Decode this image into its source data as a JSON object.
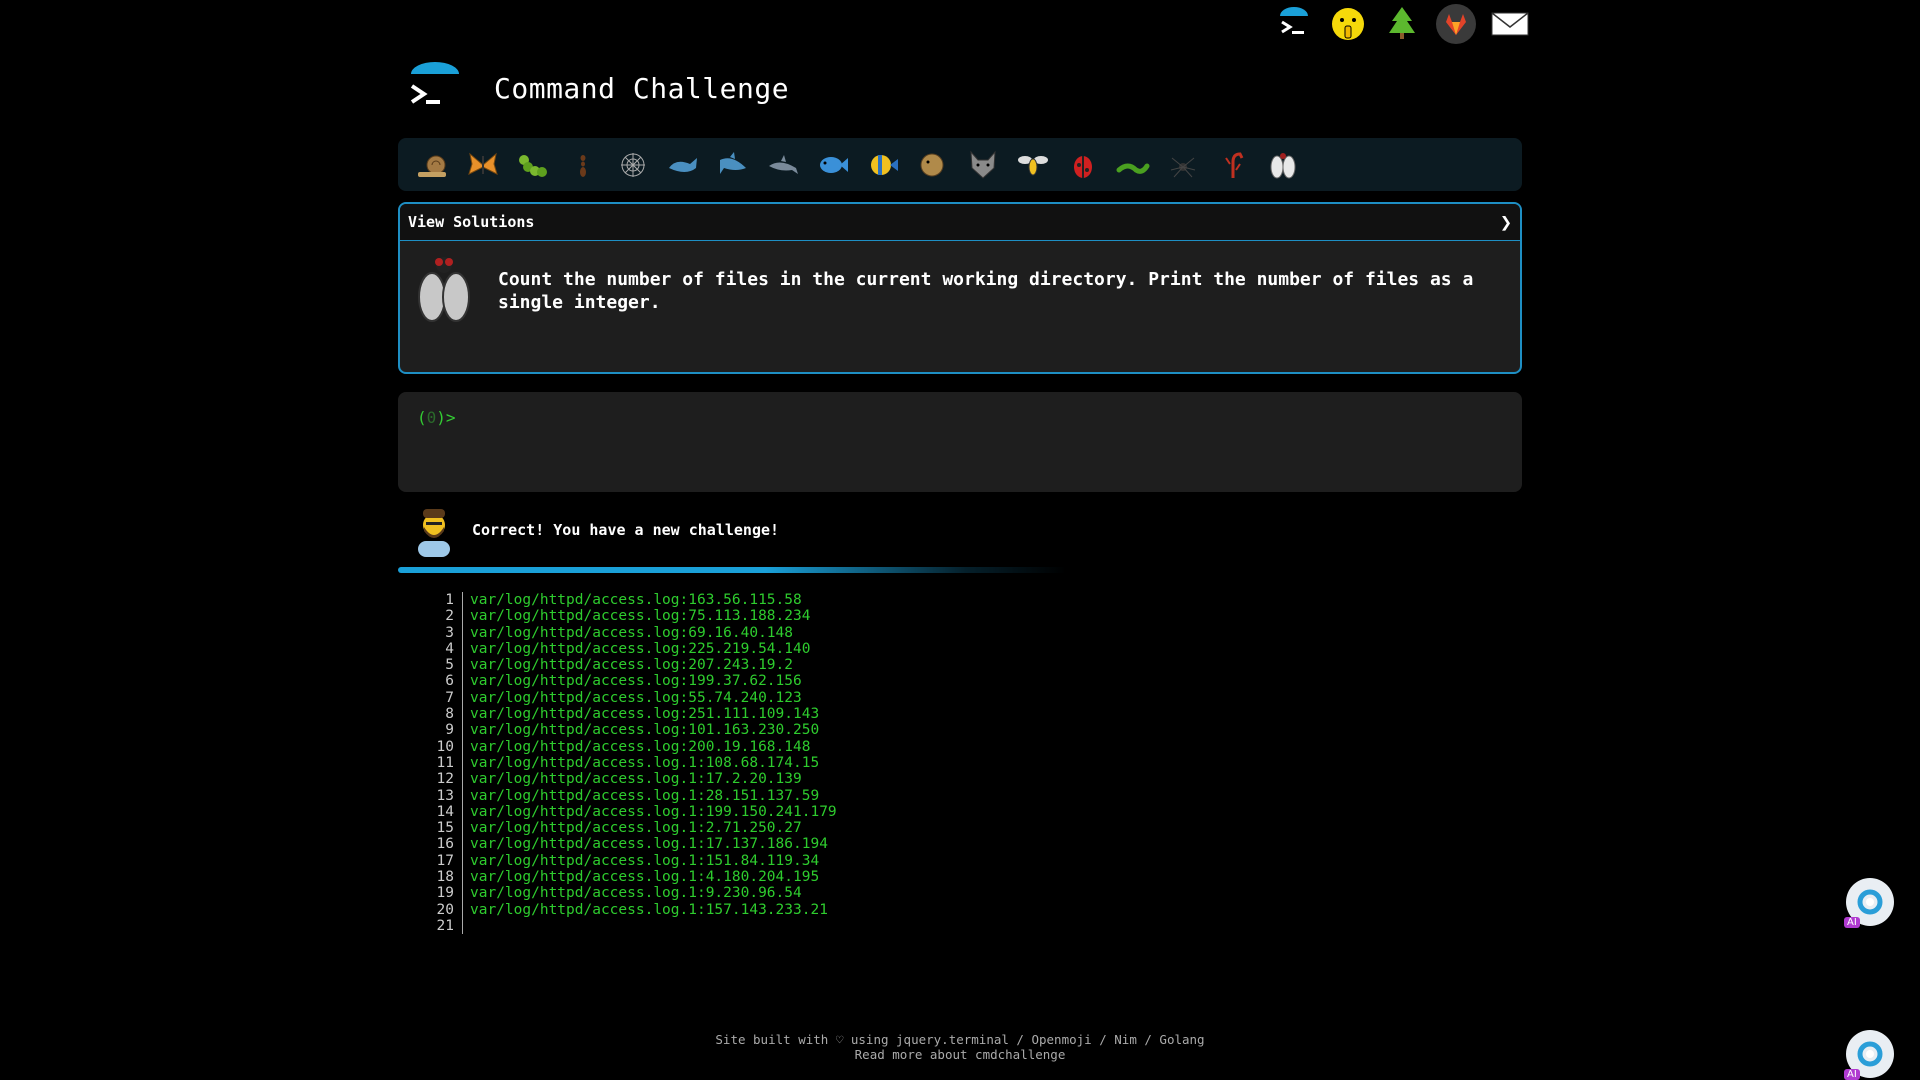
{
  "app": {
    "title": "Command Challenge"
  },
  "top_icons": [
    "terminal-icon",
    "shushing-face-icon",
    "tree-icon",
    "gitlab-icon",
    "envelope-icon"
  ],
  "emoji_bar": [
    "snail",
    "butterfly",
    "caterpillar",
    "ant",
    "spider-web",
    "whale",
    "shark",
    "dolphin",
    "fish",
    "tropical-fish",
    "blowfish",
    "wolf",
    "wasp",
    "ladybug",
    "worm",
    "spider",
    "scorpion",
    "fly"
  ],
  "solutions": {
    "label": "View Solutions",
    "chevron": "❯"
  },
  "task": {
    "text": "Count the number of files in the current working directory. Print the number of files as a single integer."
  },
  "terminal": {
    "prompt_open": "(",
    "prompt_num": "0",
    "prompt_close": ")>"
  },
  "feedback": {
    "message": "Correct! You have a new challenge!"
  },
  "output": {
    "lines": [
      {
        "n": "1",
        "text": "var/log/httpd/access.log:163.56.115.58"
      },
      {
        "n": "2",
        "text": "var/log/httpd/access.log:75.113.188.234"
      },
      {
        "n": "3",
        "text": "var/log/httpd/access.log:69.16.40.148"
      },
      {
        "n": "4",
        "text": "var/log/httpd/access.log:225.219.54.140"
      },
      {
        "n": "5",
        "text": "var/log/httpd/access.log:207.243.19.2"
      },
      {
        "n": "6",
        "text": "var/log/httpd/access.log:199.37.62.156"
      },
      {
        "n": "7",
        "text": "var/log/httpd/access.log:55.74.240.123"
      },
      {
        "n": "8",
        "text": "var/log/httpd/access.log:251.111.109.143"
      },
      {
        "n": "9",
        "text": "var/log/httpd/access.log:101.163.230.250"
      },
      {
        "n": "10",
        "text": "var/log/httpd/access.log:200.19.168.148"
      },
      {
        "n": "11",
        "text": "var/log/httpd/access.log.1:108.68.174.15"
      },
      {
        "n": "12",
        "text": "var/log/httpd/access.log.1:17.2.20.139"
      },
      {
        "n": "13",
        "text": "var/log/httpd/access.log.1:28.151.137.59"
      },
      {
        "n": "14",
        "text": "var/log/httpd/access.log.1:199.150.241.179"
      },
      {
        "n": "15",
        "text": "var/log/httpd/access.log.1:2.71.250.27"
      },
      {
        "n": "16",
        "text": "var/log/httpd/access.log.1:17.137.186.194"
      },
      {
        "n": "17",
        "text": "var/log/httpd/access.log.1:151.84.119.34"
      },
      {
        "n": "18",
        "text": "var/log/httpd/access.log.1:4.180.204.195"
      },
      {
        "n": "19",
        "text": "var/log/httpd/access.log.1:9.230.96.54"
      },
      {
        "n": "20",
        "text": "var/log/httpd/access.log.1:157.143.233.21"
      },
      {
        "n": "21",
        "text": ""
      }
    ]
  },
  "footer": {
    "line1": "Site built with ♡ using jquery.terminal / Openmoji / Nim / Golang",
    "line2": "Read more about cmdchallenge"
  },
  "floating": {
    "ai_label": "AI"
  },
  "colors": {
    "accent": "#1e8fc4",
    "output_green": "#2ecc2e",
    "panel_bg": "#1e1e1e"
  }
}
